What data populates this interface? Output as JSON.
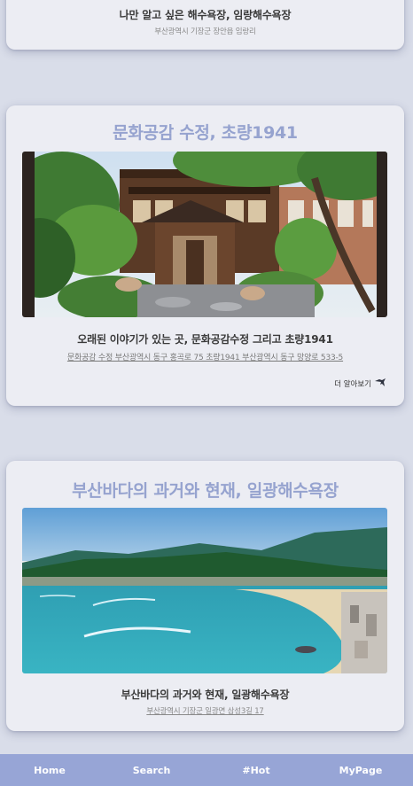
{
  "cards": [
    {
      "subtitle": "나만 알고 싶은 해수욕장, 임랑해수욕장",
      "address": "부산광역시 기장군 장안읍 임랑리"
    },
    {
      "title": "문화공감 수정, 초량1941",
      "subtitle": "오래된 이야기가 있는 곳, 문화공감수정 그리고 초량1941",
      "address": "문화공감 수정 부산광역시 동구 홍곡로 75 초량1941 부산광역시 동구 망양로 533-5",
      "more_label": "더 알아보기",
      "image_icon": "hanok-building-photo"
    },
    {
      "title": "부산바다의 과거와 현재, 일광해수욕장",
      "subtitle": "부산바다의 과거와 현재, 일광해수욕장",
      "address": "부산광역시 기장군 일광면 삼성3길 17",
      "image_icon": "beach-bay-photo"
    }
  ],
  "navbar": {
    "items": [
      "Home",
      "Search",
      "#Hot",
      "MyPage"
    ]
  },
  "colors": {
    "background": "#d9dde9",
    "card": "#ecedf3",
    "title_accent": "#96a3cf",
    "navbar": "#97a5d6"
  }
}
